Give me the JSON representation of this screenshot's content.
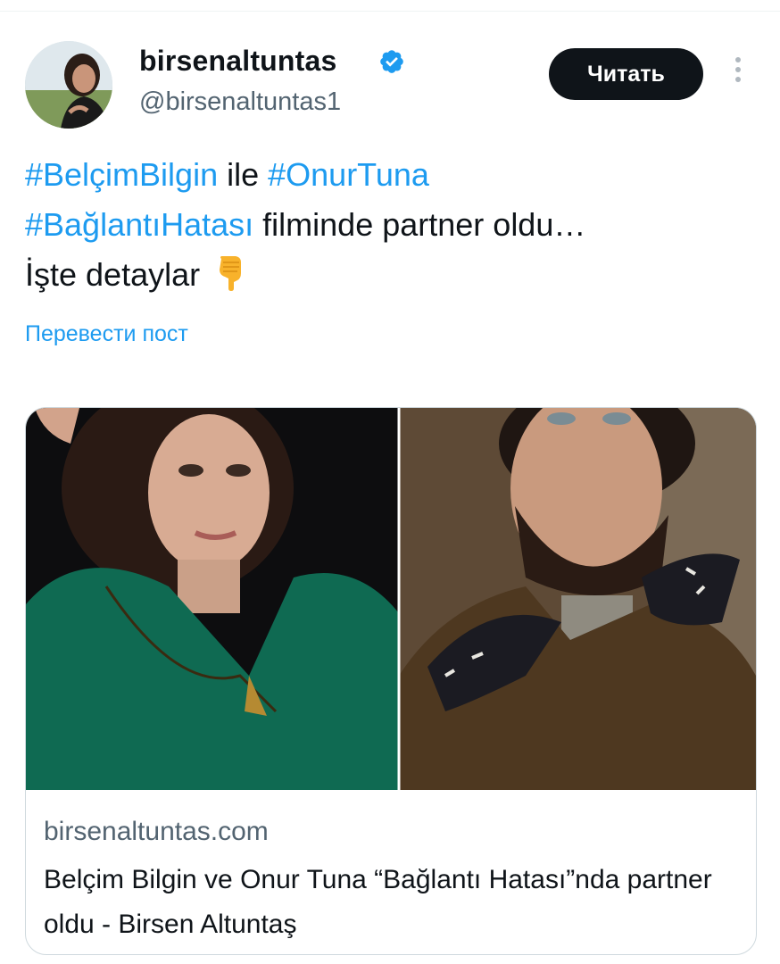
{
  "author": {
    "display_name": "birsenaltuntas",
    "handle": "@birsenaltuntas1",
    "verified": true
  },
  "follow_button": {
    "label": "Читать"
  },
  "tweet": {
    "segments": [
      {
        "text": "#BelçimBilgin",
        "hashtag": true
      },
      {
        "text": " ile ",
        "hashtag": false
      },
      {
        "text": "#OnurTuna",
        "hashtag": true
      },
      {
        "text": "\n",
        "hashtag": false
      },
      {
        "text": "#BağlantıHatası",
        "hashtag": true
      },
      {
        "text": " filminde partner oldu…",
        "hashtag": false
      },
      {
        "text": "\nİşte detaylar",
        "hashtag": false
      }
    ],
    "emoji": "backhand-index-pointing-down"
  },
  "translate_label": "Перевести пост",
  "link_card": {
    "domain": "birsenaltuntas.com",
    "title": "Belçim Bilgin ve Onur Tuna “Bağlantı Hatası”nda partner oldu - Birsen Altuntaş"
  },
  "colors": {
    "link": "#1d9bf0",
    "text": "#0f1419",
    "secondary": "#536471",
    "verified": "#1d9bf0"
  }
}
